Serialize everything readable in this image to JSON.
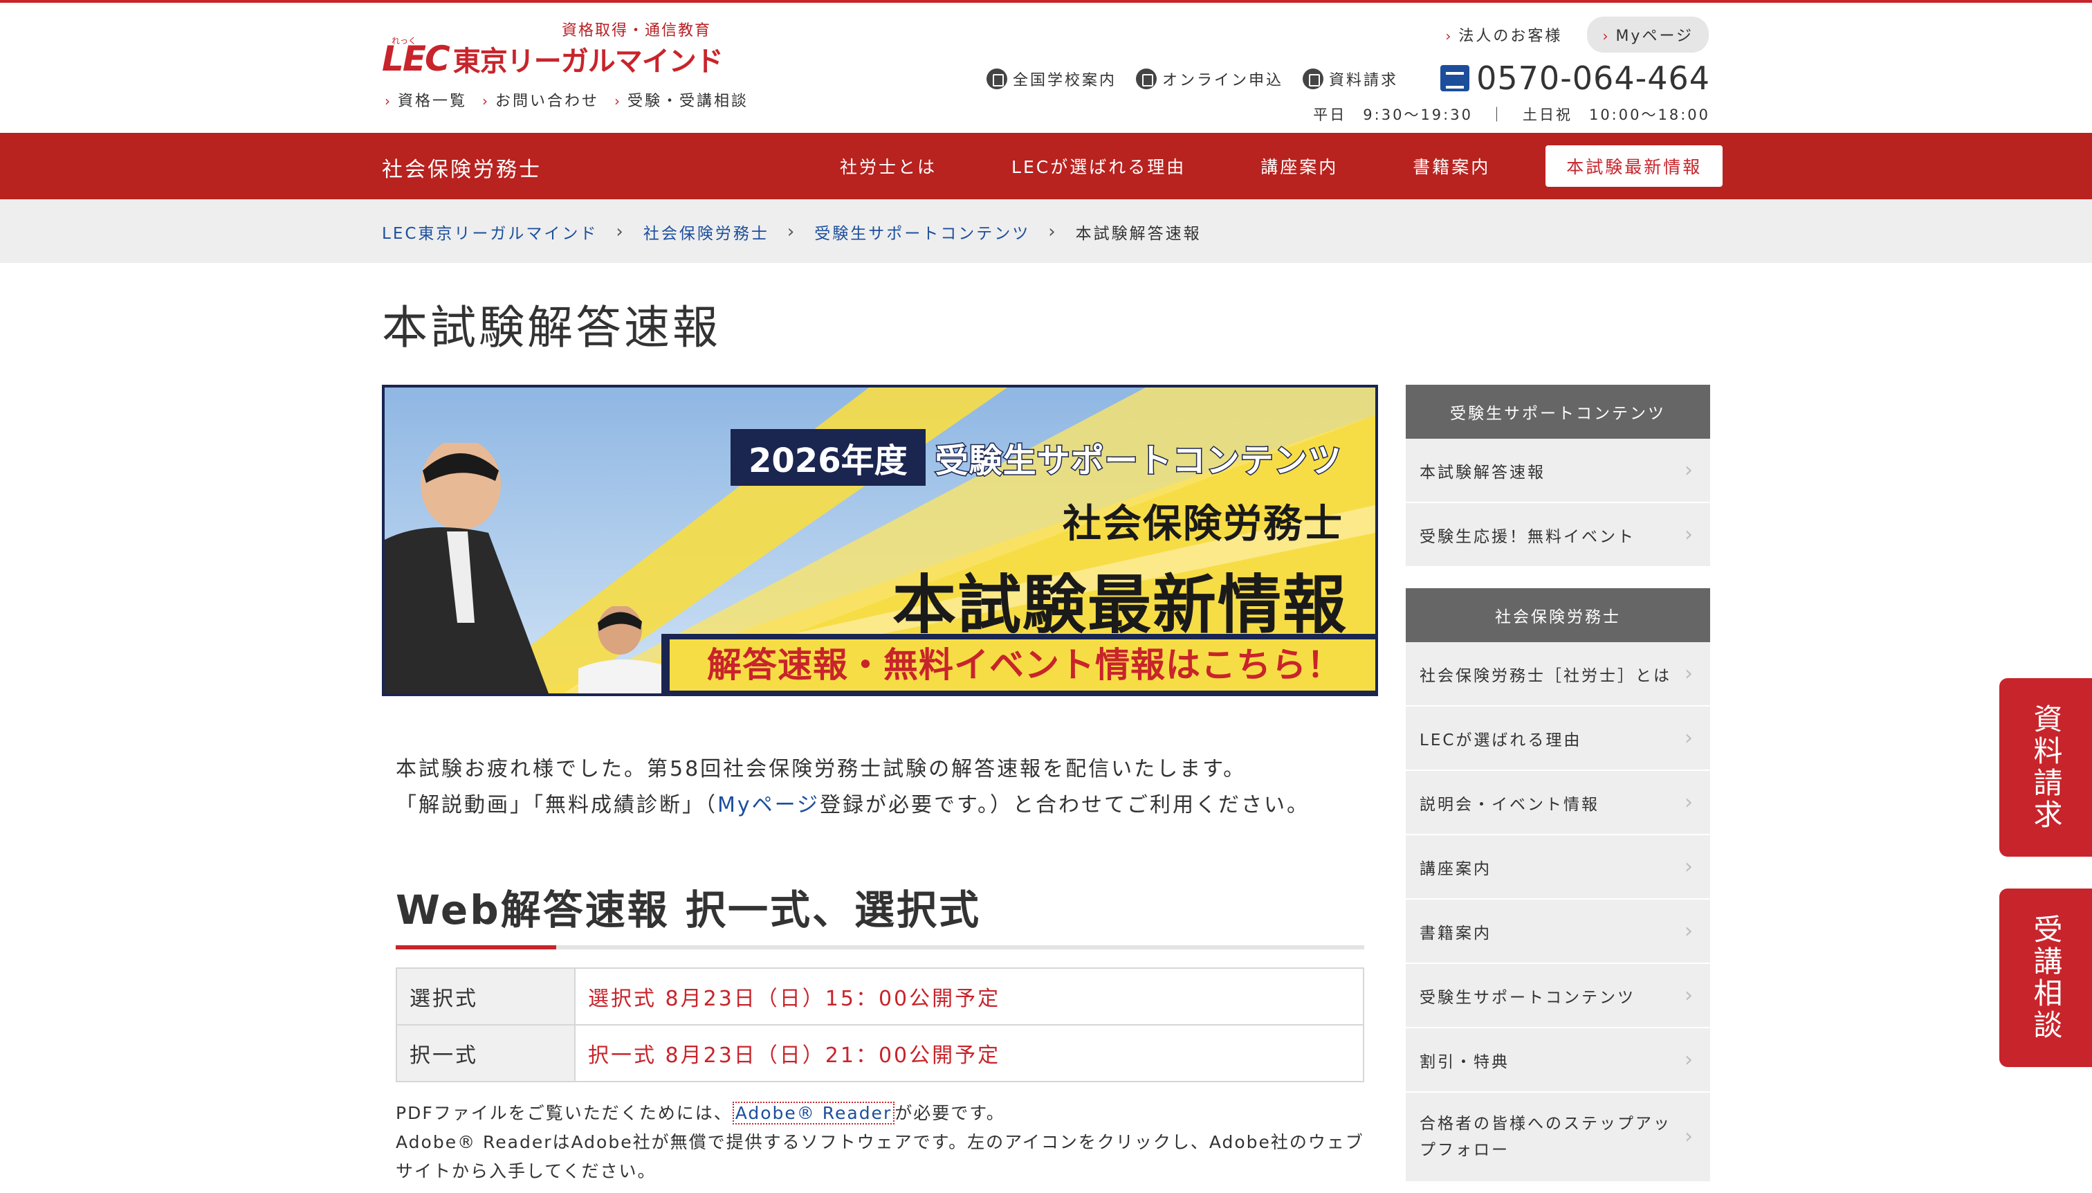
{
  "header": {
    "tagline": "資格取得・通信教育",
    "logo_mark": "LEC",
    "logo_name": "東京リーガルマインド",
    "logo_ruby": "れっく",
    "sublinks": [
      "資格一覧",
      "お問い合わせ",
      "受験・受講相談"
    ],
    "corp_link": "法人のお客様",
    "mypage": "Myページ",
    "util": [
      {
        "label": "全国学校案内",
        "icon": "building-icon"
      },
      {
        "label": "オンライン申込",
        "icon": "cart-icon"
      },
      {
        "label": "資料請求",
        "icon": "document-icon"
      }
    ],
    "phone": "0570-064-464",
    "hours": "平日　9:30〜19:30　｜　土日祝　10:00〜18:00"
  },
  "nav": {
    "category": "社会保険労務士",
    "items": [
      "社労士とは",
      "LECが選ばれる理由",
      "講座案内",
      "書籍案内"
    ],
    "active": "本試験最新情報"
  },
  "breadcrumb": [
    "LEC東京リーガルマインド",
    "社会保険労務士",
    "受験生サポートコンテンツ",
    "本試験解答速報"
  ],
  "page_title": "本試験解答速報",
  "banner": {
    "year": "2026年度",
    "label": "受験生サポートコンテンツ",
    "sub1": "社会保険労務士",
    "sub2": "本試験最新情報",
    "strip": "解答速報・無料イベント情報はこちら！"
  },
  "intro": {
    "line1": "本試験お疲れ様でした。第58回社会保険労務士試験の解答速報を配信いたします。",
    "line2_pre": "「解説動画」「無料成績診断」（",
    "line2_link": "Myページ",
    "line2_post": "登録が必要です。）と合わせてご利用ください。"
  },
  "section": {
    "title": "Web解答速報 択一式、選択式",
    "rows": [
      {
        "key": "選択式",
        "value": "選択式 8月23日（日）15：00公開予定"
      },
      {
        "key": "択一式",
        "value": "択一式 8月23日（日）21：00公開予定"
      }
    ]
  },
  "pdf_note": {
    "pre": "PDFファイルをご覧いただくためには、",
    "link": "Adobe® Reader",
    "post": "が必要です。",
    "line2": "Adobe® ReaderはAdobe社が無償で提供するソフトウェアです。左のアイコンをクリックし、Adobe社のウェブサイトから入手してください。"
  },
  "sidebar": {
    "box1": {
      "head": "受験生サポートコンテンツ",
      "items": [
        "本試験解答速報",
        "受験生応援！無料イベント"
      ]
    },
    "box2": {
      "head": "社会保険労務士",
      "items": [
        "社会保険労務士［社労士］とは",
        "LECが選ばれる理由",
        "説明会・イベント情報",
        "講座案内",
        "書籍案内",
        "受験生サポートコンテンツ",
        "割引・特典",
        "合格者の皆様へのステップアップフォロー"
      ]
    }
  },
  "float_tabs": {
    "request": "資料請求",
    "consult": "受講相談"
  }
}
